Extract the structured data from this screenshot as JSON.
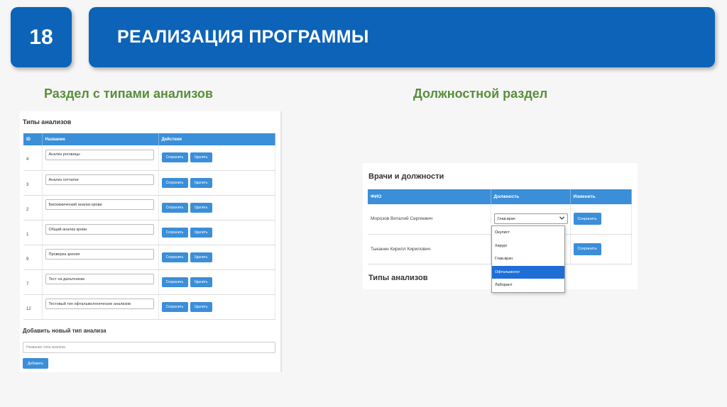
{
  "slide": {
    "number": "18",
    "title": "РЕАЛИЗАЦИЯ ПРОГРАММЫ",
    "left_caption": "Раздел с типами анализов",
    "right_caption": "Должностной раздел"
  },
  "analysis_panel": {
    "heading": "Типы анализов",
    "columns": [
      "ID",
      "Название",
      "Действия"
    ],
    "rows": [
      {
        "id": "4",
        "name": "Анализ роговицы"
      },
      {
        "id": "3",
        "name": "Анализ сетчатки"
      },
      {
        "id": "2",
        "name": "Биохимический анализ крови"
      },
      {
        "id": "1",
        "name": "Общий анализ крови"
      },
      {
        "id": "9",
        "name": "Проверка зрения"
      },
      {
        "id": "7",
        "name": "Тест на дальтонизм"
      },
      {
        "id": "12",
        "name": "Тестовый тип офтальмологических анализов"
      }
    ],
    "save_label": "Сохранить",
    "delete_label": "Удалить",
    "add_heading": "Добавить новый тип анализа",
    "add_placeholder": "Название типа анализа",
    "add_button": "Добавить"
  },
  "doctors_panel": {
    "heading": "Врачи и должности",
    "columns": [
      "ФИО",
      "Должность",
      "Изменить"
    ],
    "rows": [
      {
        "name": "Морозов Виталий Сергеевич",
        "position": "Глав.врач"
      },
      {
        "name": "Тыканин Кирилл Кирилович",
        "position": ""
      }
    ],
    "save_label": "Сохранить",
    "dropdown_options": [
      "Окулист",
      "Хирург",
      "Глав.врач",
      "Офтальмолог",
      "Лаборант"
    ],
    "highlighted_option": "Офтальмолог",
    "sub_heading": "Типы анализов"
  },
  "colors": {
    "brand_blue": "#0c63b8",
    "table_header": "#3b8ed8",
    "caption_green": "#5a8e3c",
    "dropdown_highlight": "#1e6ed6"
  }
}
